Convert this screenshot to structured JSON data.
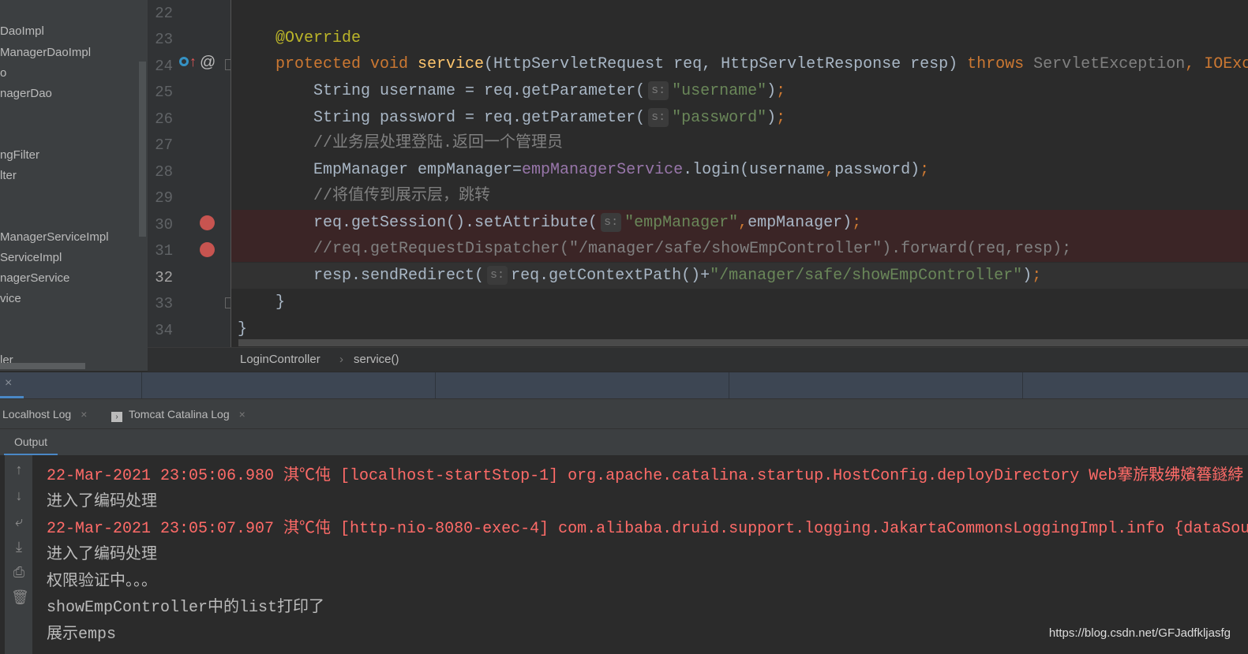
{
  "sidebar": {
    "items": [
      "DaoImpl",
      "ManagerDaoImpl",
      "o",
      "nagerDao",
      "ngFilter",
      "lter",
      "ManagerServiceImpl",
      "ServiceImpl",
      "nagerService",
      "vice",
      "ler"
    ]
  },
  "editor": {
    "lines": [
      22,
      23,
      24,
      25,
      26,
      27,
      28,
      29,
      30,
      31,
      32,
      33,
      34
    ],
    "current_line": 32,
    "breakpoints": [
      30,
      31
    ],
    "code": {
      "l23": "@Override",
      "l24_kw": "protected void ",
      "l24_m": "service",
      "l24_a": "(HttpServletRequest req, HttpServletResponse resp) ",
      "l24_t": "throws ",
      "l24_e": "ServletException",
      "l24_b": ", IOExc",
      "l25_a": "String username = req.getParameter(",
      "l25_s": "\"username\"",
      "l25_b": ")",
      "semi": ";",
      "l26_a": "String password = req.getParameter(",
      "l26_s": "\"password\"",
      "l26_b": ")",
      "l27": "//业务层处理登陆.返回一个管理员",
      "l28_a": "EmpManager empManager=",
      "l28_f": "empManagerService",
      "l28_b": ".login(username",
      "comma": ",",
      "l28_c": "password)",
      "l29": "//将值传到展示层，跳转",
      "l30_a": "req.getSession().setAttribute(",
      "l30_s": "\"empManager\"",
      "l30_b": "empManager)",
      "l31": "//req.getRequestDispatcher(\"/manager/safe/showEmpController\").forward(req,resp);",
      "l32_a": "resp.sendRedirect(",
      "l32_b": "req.getContextPath()+",
      "l32_s": "\"/manager/safe/showEmpController\"",
      "l32_c": ")",
      "l33": "}",
      "l34": "}",
      "hint": "s:"
    }
  },
  "breadcrumb": {
    "class": "LoginController",
    "sep": "›",
    "method": "service()"
  },
  "tabs": [
    {
      "label": "Localhost Log",
      "close": "×"
    },
    {
      "label": "Tomcat Catalina Log",
      "close": "×"
    }
  ],
  "header_close": "×",
  "output_tab": "Output",
  "console": {
    "lines": [
      {
        "text": "22-Mar-2021 23:05:06.980 淇℃伅 [localhost-startStop-1] org.apache.catalina.startup.HostConfig.deployDirectory Web搴旂敤绋嬪簭鐩綍",
        "type": "error"
      },
      {
        "text": "进入了编码处理",
        "type": "normal"
      },
      {
        "text": "22-Mar-2021 23:05:07.907 淇℃伅 [http-nio-8080-exec-4] com.alibaba.druid.support.logging.JakartaCommonsLoggingImpl.info {dataSource",
        "type": "error"
      },
      {
        "text": "进入了编码处理",
        "type": "normal"
      },
      {
        "text": "权限验证中。。。",
        "type": "normal"
      },
      {
        "text": "showEmpController中的list打印了",
        "type": "normal"
      },
      {
        "text": "展示emps",
        "type": "normal"
      }
    ]
  },
  "watermark": "https://blog.csdn.net/GFJadfkljasfg",
  "colors": {
    "keyword": "#cc7832",
    "method": "#ffc66d",
    "string": "#6a8759",
    "comment": "#808080",
    "field": "#9876aa",
    "annotation": "#bbb529",
    "error": "#ff6b68",
    "breakpoint": "#c75450"
  }
}
